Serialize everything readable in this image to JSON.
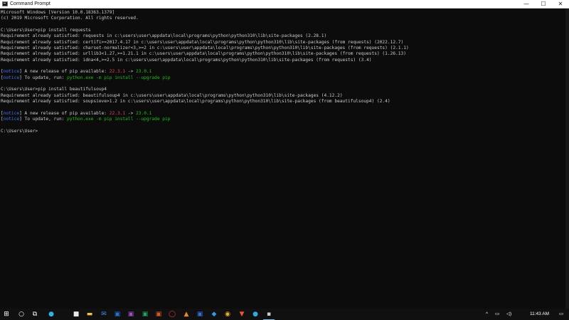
{
  "window": {
    "title": "Command Prompt",
    "icon": "cmd-icon",
    "controls": {
      "minimize": "—",
      "maximize": "☐",
      "close": "✕"
    }
  },
  "console": {
    "lines": [
      {
        "segments": [
          {
            "text": "Microsoft Windows [Version 10.0.18363.1379]",
            "style": "default"
          }
        ]
      },
      {
        "segments": [
          {
            "text": "(c) 2019 Microsoft Corporation. All rights reserved.",
            "style": "default"
          }
        ]
      },
      {
        "segments": [
          {
            "text": "",
            "style": "default"
          }
        ]
      },
      {
        "segments": [
          {
            "text": "C:\\Users\\User>pip install requests",
            "style": "default"
          }
        ]
      },
      {
        "segments": [
          {
            "text": "Requirement already satisfied: requests in c:\\users\\user\\appdata\\local\\programs\\python\\python310\\lib\\site-packages (2.28.1)",
            "style": "default"
          }
        ]
      },
      {
        "segments": [
          {
            "text": "Requirement already satisfied: certifi>=2017.4.17 in c:\\users\\user\\appdata\\local\\programs\\python\\python310\\lib\\site-packages (from requests) (2022.12.7)",
            "style": "default"
          }
        ]
      },
      {
        "segments": [
          {
            "text": "Requirement already satisfied: charset-normalizer<3,>=2 in c:\\users\\user\\appdata\\local\\programs\\python\\python310\\lib\\site-packages (from requests) (2.1.1)",
            "style": "default"
          }
        ]
      },
      {
        "segments": [
          {
            "text": "Requirement already satisfied: urllib3<1.27,>=1.21.1 in c:\\users\\user\\appdata\\local\\programs\\python\\python310\\lib\\site-packages (from requests) (1.26.13)",
            "style": "default"
          }
        ]
      },
      {
        "segments": [
          {
            "text": "Requirement already satisfied: idna<4,>=2.5 in c:\\users\\user\\appdata\\local\\programs\\python\\python310\\lib\\site-packages (from requests) (3.4)",
            "style": "default"
          }
        ]
      },
      {
        "segments": [
          {
            "text": "",
            "style": "default"
          }
        ]
      },
      {
        "segments": [
          {
            "text": "[",
            "style": "default"
          },
          {
            "text": "notice",
            "style": "notice"
          },
          {
            "text": "] A new release of pip available: ",
            "style": "default"
          },
          {
            "text": "22.3.1",
            "style": "red"
          },
          {
            "text": " -> ",
            "style": "default"
          },
          {
            "text": "23.0.1",
            "style": "green"
          }
        ]
      },
      {
        "segments": [
          {
            "text": "[",
            "style": "default"
          },
          {
            "text": "notice",
            "style": "notice"
          },
          {
            "text": "] To update, run: ",
            "style": "default"
          },
          {
            "text": "python.exe -m pip install --upgrade pip",
            "style": "green"
          }
        ]
      },
      {
        "segments": [
          {
            "text": "",
            "style": "default"
          }
        ]
      },
      {
        "segments": [
          {
            "text": "C:\\Users\\User>pip install beautifulsoup4",
            "style": "default"
          }
        ]
      },
      {
        "segments": [
          {
            "text": "Requirement already satisfied: beautifulsoup4 in c:\\users\\user\\appdata\\local\\programs\\python\\python310\\lib\\site-packages (4.12.2)",
            "style": "default"
          }
        ]
      },
      {
        "segments": [
          {
            "text": "Requirement already satisfied: soupsieve>1.2 in c:\\users\\user\\appdata\\local\\programs\\python\\python310\\lib\\site-packages (from beautifulsoup4) (2.4)",
            "style": "default"
          }
        ]
      },
      {
        "segments": [
          {
            "text": "",
            "style": "default"
          }
        ]
      },
      {
        "segments": [
          {
            "text": "[",
            "style": "default"
          },
          {
            "text": "notice",
            "style": "notice"
          },
          {
            "text": "] A new release of pip available: ",
            "style": "default"
          },
          {
            "text": "22.3.1",
            "style": "red"
          },
          {
            "text": " -> ",
            "style": "default"
          },
          {
            "text": "23.0.1",
            "style": "green"
          }
        ]
      },
      {
        "segments": [
          {
            "text": "[",
            "style": "default"
          },
          {
            "text": "notice",
            "style": "notice"
          },
          {
            "text": "] To update, run: ",
            "style": "default"
          },
          {
            "text": "python.exe -m pip install --upgrade pip",
            "style": "green"
          }
        ]
      },
      {
        "segments": [
          {
            "text": "",
            "style": "default"
          }
        ]
      },
      {
        "segments": [
          {
            "text": "C:\\Users\\User>",
            "style": "default"
          }
        ]
      }
    ]
  },
  "colors": {
    "console_bg": "#0c0c0c",
    "console_text": "#cccccc",
    "notice": "#3b78ff",
    "old_version": "#e74856",
    "new_version": "#16c60c",
    "taskbar_bg": "#101010"
  },
  "taskbar": {
    "items": [
      {
        "name": "start-button",
        "icon": "windows-logo-icon",
        "glyph": "⊞",
        "color": "#ffffff",
        "interactable": true
      },
      {
        "name": "search-button",
        "icon": "search-icon",
        "glyph": "○",
        "color": "#ffffff",
        "interactable": true
      },
      {
        "name": "task-view-button",
        "icon": "task-view-icon",
        "glyph": "⧉",
        "color": "#ffffff",
        "interactable": true
      },
      {
        "name": "edge-app",
        "icon": "edge-icon",
        "glyph": "●",
        "color": "#2fb3e6",
        "interactable": true
      },
      {
        "name": "store-app",
        "icon": "store-icon",
        "glyph": "■",
        "color": "#e8e8e8",
        "interactable": true
      },
      {
        "name": "file-explorer-app",
        "icon": "folder-icon",
        "glyph": "▬",
        "color": "#f5c342",
        "interactable": true
      },
      {
        "name": "mail-app",
        "icon": "mail-icon",
        "glyph": "✉",
        "color": "#3d8ee6",
        "interactable": true
      },
      {
        "name": "outlook-app",
        "icon": "outlook-icon",
        "glyph": "▣",
        "color": "#1f74d4",
        "interactable": true
      },
      {
        "name": "onenote-app",
        "icon": "onenote-icon",
        "glyph": "▣",
        "color": "#9b4fc4",
        "interactable": true
      },
      {
        "name": "excel-app",
        "icon": "excel-icon",
        "glyph": "▣",
        "color": "#21a366",
        "interactable": true
      },
      {
        "name": "powerpoint-app",
        "icon": "powerpoint-icon",
        "glyph": "▣",
        "color": "#d8572a",
        "interactable": true
      },
      {
        "name": "opera-app",
        "icon": "opera-icon",
        "glyph": "◯",
        "color": "#e53939",
        "interactable": true
      },
      {
        "name": "vlc-app",
        "icon": "vlc-icon",
        "glyph": "▲",
        "color": "#f08a1d",
        "interactable": true
      },
      {
        "name": "word-app",
        "icon": "word-icon",
        "glyph": "▣",
        "color": "#2f6fd6",
        "interactable": true
      },
      {
        "name": "vscode-app",
        "icon": "vscode-icon",
        "glyph": "◆",
        "color": "#2f9bf0",
        "interactable": true
      },
      {
        "name": "chrome-app",
        "icon": "chrome-icon",
        "glyph": "◉",
        "color": "#e9b22e",
        "interactable": true
      },
      {
        "name": "brave-app",
        "icon": "brave-icon",
        "glyph": "▼",
        "color": "#f0532d",
        "interactable": true
      },
      {
        "name": "telegram-app",
        "icon": "telegram-icon",
        "glyph": "●",
        "color": "#35a6de",
        "interactable": true
      },
      {
        "name": "terminal-app",
        "icon": "terminal-icon",
        "glyph": "▪",
        "color": "#cccccc",
        "interactable": true,
        "active": true
      }
    ],
    "tray": {
      "chevron": "^",
      "network_icon": "▭",
      "volume_icon": "◁)",
      "time": "11:43 AM",
      "notification_icon": "▭"
    }
  }
}
